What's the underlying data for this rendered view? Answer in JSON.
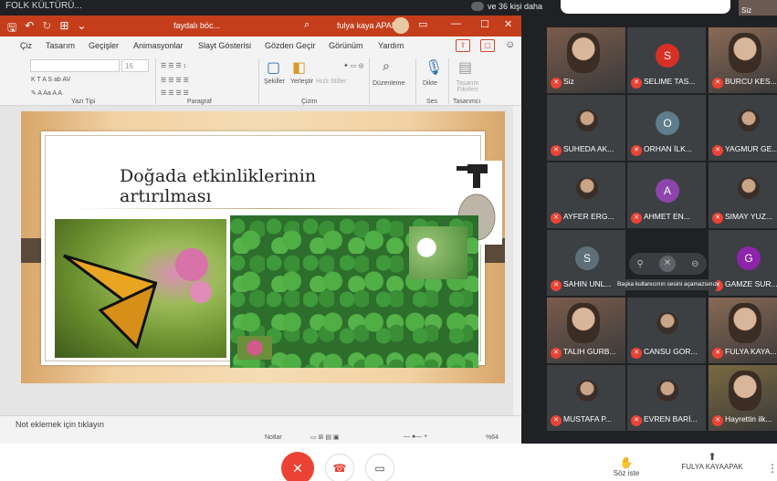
{
  "topbar": {
    "meet_title": "FOLK KÜLTÜRÜ...",
    "more_people": "ve 36 kişi daha",
    "self_thumb_label": "Siz"
  },
  "ppt": {
    "title_file": "faydalı böc...",
    "user_name": "fulya kaya APAK",
    "menu": [
      "Çiz",
      "Tasarım",
      "Geçişler",
      "Animasyonlar",
      "Slayt Gösterisi",
      "Gözden Geçir",
      "Görünüm",
      "Yardım"
    ],
    "font_size": "16",
    "ribbon_groups": {
      "font": "Yazı Tipi",
      "paragraph": "Paragraf",
      "drawing": "Çizim",
      "voice": "Ses",
      "designer": "Tasarımcı"
    },
    "ribbon_buttons": {
      "shapes": "Şekiller",
      "arrange": "Yerleştir",
      "quick_styles": "Hızlı Stiller",
      "editing": "Düzenleme",
      "dictate": "Dikte",
      "designer_ideas": "Tasarım Fikirleri"
    },
    "slide_title": "Doğada etkinliklerinin artırılması",
    "notes_placeholder": "Not eklemek için tıklayın",
    "status_notes": "Notlar",
    "zoom": "%64"
  },
  "participants": [
    {
      "name": "Siz",
      "kind": "video"
    },
    {
      "name": "SELIME TAS...",
      "kind": "letter",
      "letter": "S",
      "color": "#d93025"
    },
    {
      "name": "BURCU KES...",
      "kind": "video"
    },
    {
      "name": "SUHEDA AK...",
      "kind": "photo"
    },
    {
      "name": "ORHAN İLK...",
      "kind": "letter",
      "letter": "O",
      "color": "#5f7d8c"
    },
    {
      "name": "YAGMUR GE...",
      "kind": "photo"
    },
    {
      "name": "AYFER ERG...",
      "kind": "photo"
    },
    {
      "name": "AHMET EN...",
      "kind": "letter",
      "letter": "A",
      "color": "#8e44ad"
    },
    {
      "name": "SIMAY YUZ...",
      "kind": "photo"
    },
    {
      "name": "SAHIN UNL...",
      "kind": "letter",
      "letter": "S",
      "color": "#5f6f7a"
    },
    {
      "name": "",
      "kind": "hover"
    },
    {
      "name": "GAMZE SUR...",
      "kind": "letter",
      "letter": "G",
      "color": "#8e24aa"
    },
    {
      "name": "TALIH GURB...",
      "kind": "video"
    },
    {
      "name": "CANSU GOR...",
      "kind": "photo"
    },
    {
      "name": "FULYA KAYA...",
      "kind": "video"
    },
    {
      "name": "MUSTAFA P...",
      "kind": "photo"
    },
    {
      "name": "EVREN BARİ...",
      "kind": "photo"
    },
    {
      "name": "Hayrettin ilk...",
      "kind": "video"
    }
  ],
  "hover_tooltip": "Başka kullanıcının sesini açamazsınız",
  "bottombar": {
    "raise_hand": "Söz iste",
    "presenting": "FULYA KAYAAPAK"
  },
  "colors": {
    "ppt_accent": "#c43e1c",
    "mic_off": "#ea4335"
  }
}
